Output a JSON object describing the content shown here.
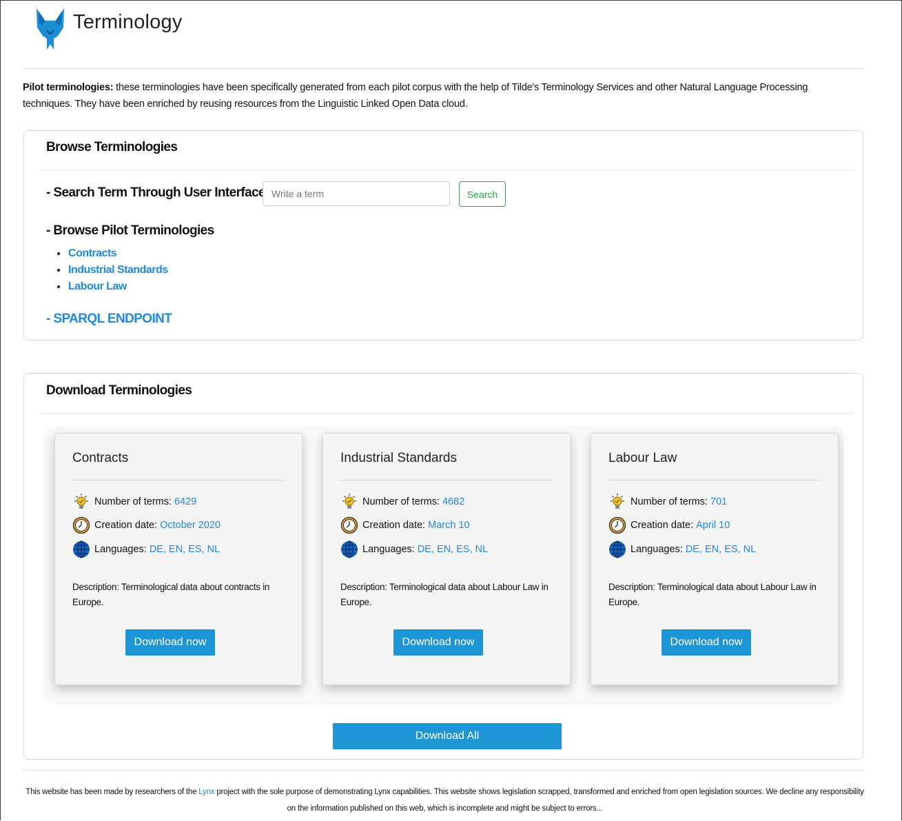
{
  "header": {
    "title": "Terminology"
  },
  "intro": {
    "label": "Pilot terminologies:",
    "text": " these terminologies have been specifically generated from each pilot corpus with the help of Tilde's Terminology Services and other Natural Language Processing techniques. They have been enriched by reusing resources from the Linguistic Linked Open Data cloud."
  },
  "browse": {
    "title": "Browse Terminologies",
    "search_label": "- Search Term Through User Interface",
    "search_placeholder": "Write a term",
    "search_button": "Search",
    "pilots_title": "- Browse Pilot Terminologies",
    "pilots": [
      "Contracts",
      "Industrial Standards",
      "Labour Law"
    ],
    "sparql": "- SPARQL ENDPOINT"
  },
  "download": {
    "title": "Download Terminologies",
    "terms_label": "Number of terms:",
    "date_label": "Creation date:",
    "lang_label": "Languages:",
    "cards": [
      {
        "title": "Contracts",
        "terms": "6429",
        "date": "October 2020",
        "languages": "DE, EN, ES, NL",
        "description": "Description: Terminological data about contracts in Europe.",
        "button": "Download now"
      },
      {
        "title": "Industrial Standards",
        "terms": "4682",
        "date": "March 10",
        "languages": "DE, EN, ES, NL",
        "description": "Description: Terminological data about Labour Law in Europe.",
        "button": "Download now"
      },
      {
        "title": "Labour Law",
        "terms": "701",
        "date": "April 10",
        "languages": "DE, EN, ES, NL",
        "description": "Description: Terminological data about Labour Law in Europe.",
        "button": "Download now"
      }
    ],
    "download_all": "Download All"
  },
  "footer": {
    "before": "This website has been made by researchers of the ",
    "link": "Lynx",
    "after": " project with the sole purpose of demonstrating Lynx capabilities. This website shows legislation scrapped, transformed and enriched from open legislation sources. We decline any responsibility on the information published on this web, which is incomplete and might be subject to errors..."
  },
  "colors": {
    "link": "#1e88e5",
    "button": "#1e96d6",
    "search_green": "#28a745",
    "logo": "#1c8fd4"
  }
}
